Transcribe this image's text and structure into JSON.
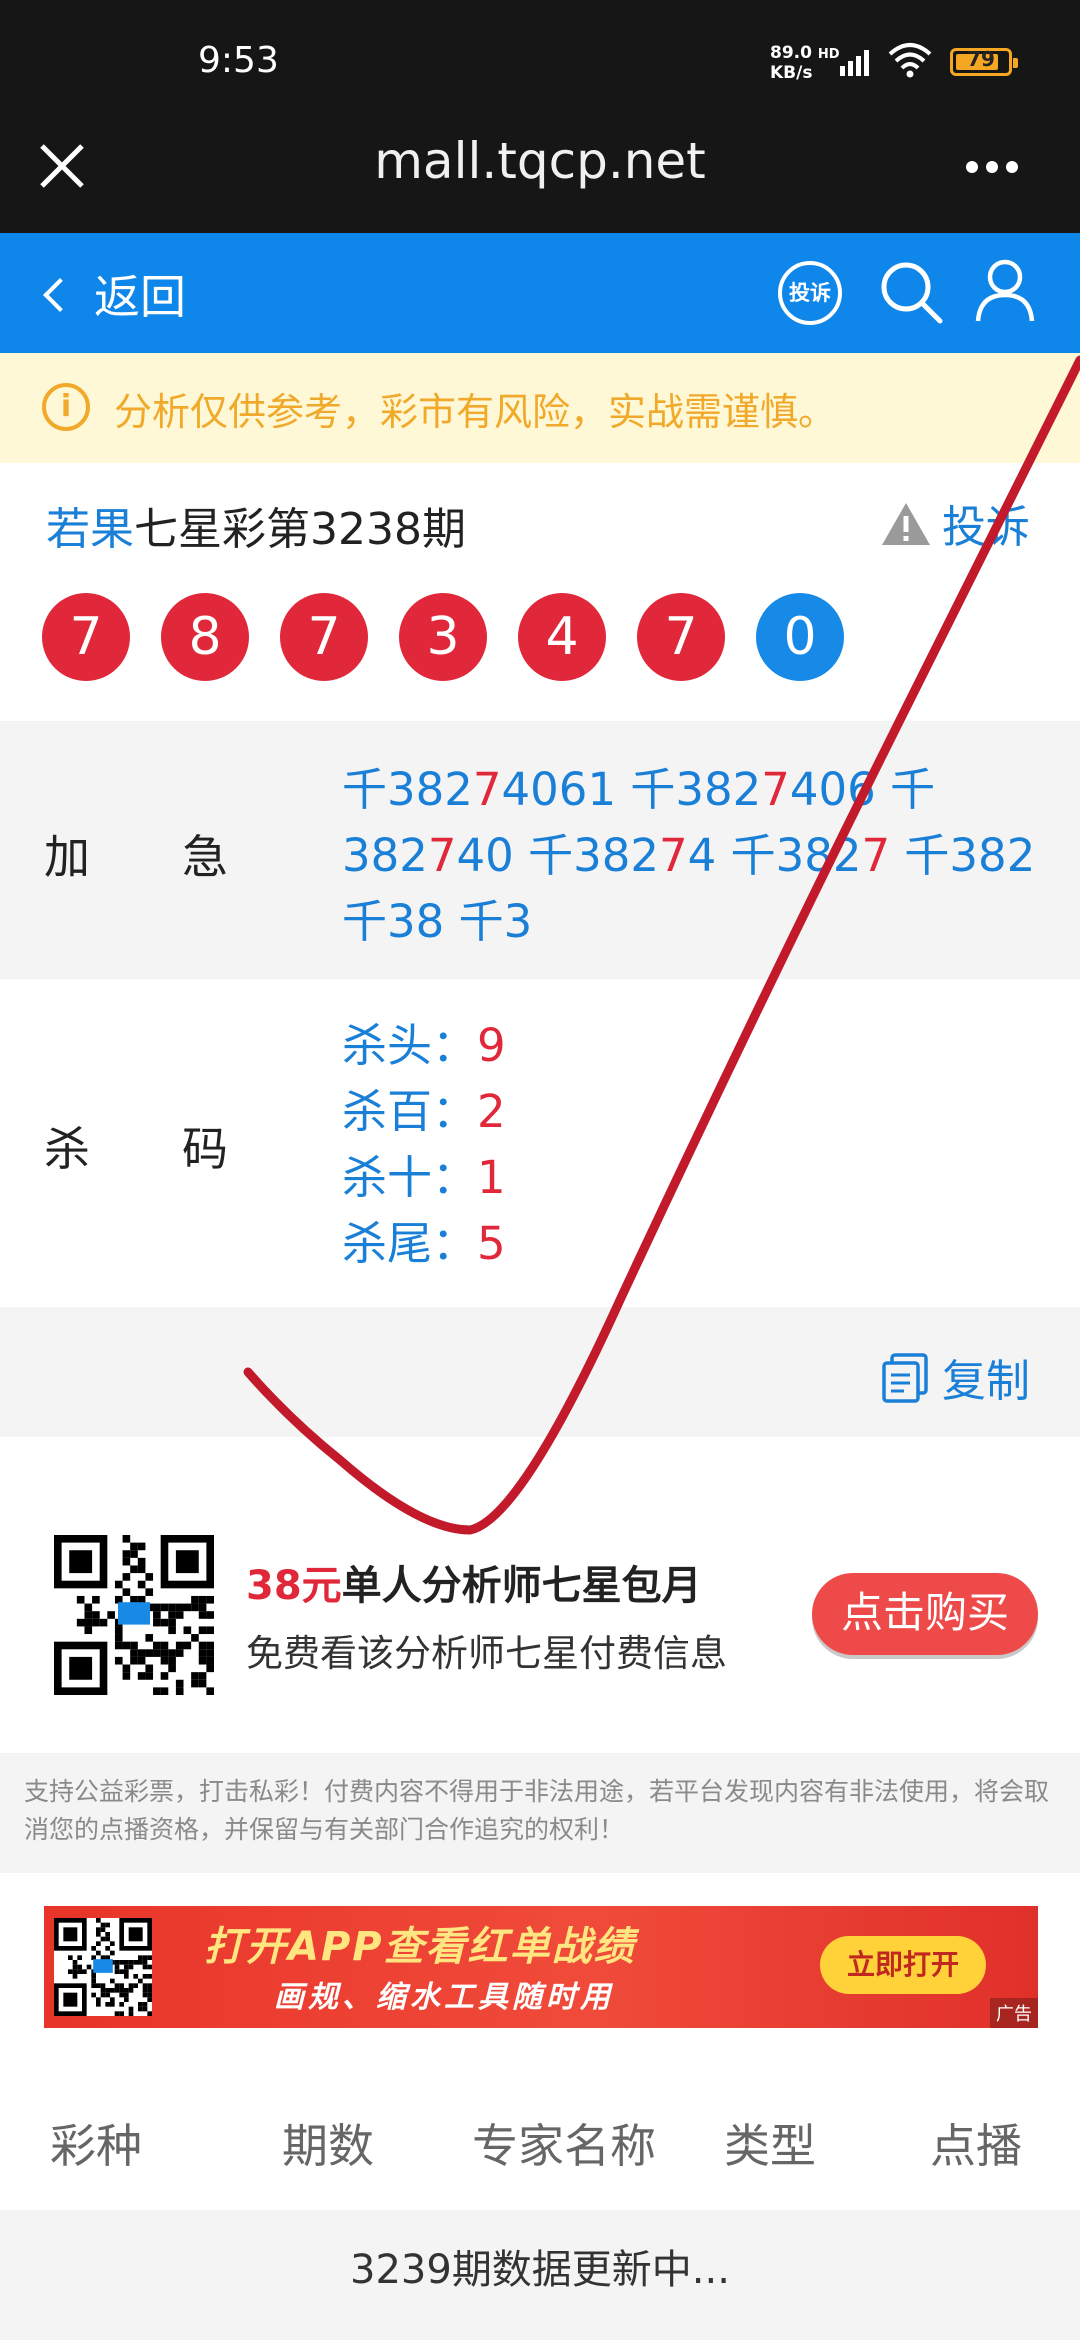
{
  "status_bar": {
    "time": "9:53",
    "net_speed_top": "89.0",
    "net_speed_bottom": "KB/s",
    "hd": "HD",
    "battery": "79"
  },
  "browser": {
    "url": "mall.tqcp.net"
  },
  "header": {
    "back_label": "返回",
    "complain_icon_label": "投诉"
  },
  "warning": {
    "text": "分析仅供参考，彩市有风险，实战需谨慎。"
  },
  "issue": {
    "expert": "若果",
    "title": "七星彩第3238期",
    "report_label": "投诉",
    "balls": [
      "7",
      "8",
      "7",
      "3",
      "4",
      "7",
      "0"
    ],
    "ball_colors": [
      "red",
      "red",
      "red",
      "red",
      "red",
      "red",
      "blue"
    ]
  },
  "plus_row": {
    "label_a": "加",
    "label_b": "急",
    "segments": [
      {
        "t": "千382",
        "r": false
      },
      {
        "t": "7",
        "r": true
      },
      {
        "t": "4061 千382",
        "r": false
      },
      {
        "t": "7",
        "r": true
      },
      {
        "t": "406 千382",
        "r": false
      },
      {
        "t": "7",
        "r": true
      },
      {
        "t": "40 千382",
        "r": false
      },
      {
        "t": "7",
        "r": true
      },
      {
        "t": "4 千382",
        "r": false
      },
      {
        "t": "7",
        "r": true
      },
      {
        "t": " 千382 千38 千3",
        "r": false
      }
    ]
  },
  "kill_row": {
    "label_a": "杀",
    "label_b": "码",
    "items": [
      {
        "k": "杀头：",
        "v": "9"
      },
      {
        "k": "杀百：",
        "v": "2"
      },
      {
        "k": "杀十：",
        "v": "1"
      },
      {
        "k": "杀尾：",
        "v": "5"
      }
    ]
  },
  "copy_label": "复制",
  "promo": {
    "price": "38元",
    "title": "单人分析师七星包月",
    "subtitle": "免费看该分析师七星付费信息",
    "button": "点击购买"
  },
  "disclaimer": "支持公益彩票，打击私彩！付费内容不得用于非法用途，若平台发现内容有非法使用，将会取消您的点播资格，并保留与有关部门合作追究的权利！",
  "ad": {
    "line1": "打开APP查看红单战绩",
    "line2": "画规、缩水工具随时用",
    "button": "立即打开",
    "tag": "广告"
  },
  "table": {
    "columns": [
      "彩种",
      "期数",
      "专家名称",
      "类型",
      "点播"
    ],
    "updating": "3239期数据更新中..."
  },
  "colors": {
    "header_blue": "#0e86ea",
    "ball_red": "#e0283a",
    "ball_blue": "#1789e6",
    "warning_text": "#f0a92a",
    "link_blue": "#1a7fd6"
  }
}
